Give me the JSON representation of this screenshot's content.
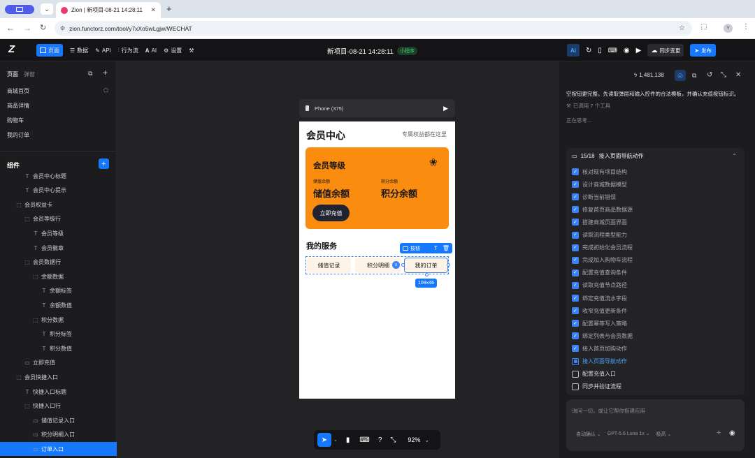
{
  "browser": {
    "tab_title": "Zion | 新项目-08-21 14:28:11",
    "new_tab": "+",
    "url": "zion.functorz.com/tool/y7xXo5wLgjw/WECHAT",
    "profile": "Y"
  },
  "topbar": {
    "logo": "Z",
    "nav": [
      {
        "label": "页面",
        "icon": "pages-icon"
      },
      {
        "label": "数据",
        "icon": "database-icon"
      },
      {
        "label": "API",
        "icon": "api-icon"
      },
      {
        "label": "行为流",
        "icon": "flow-icon"
      },
      {
        "label": "AI",
        "icon": "ai-icon"
      },
      {
        "label": "设置",
        "icon": "gear-icon"
      }
    ],
    "project_title": "新项目-08-21 14:28:11",
    "platform_badge": "小程序",
    "ai_label": "Ai",
    "sync_label": "同步变更",
    "publish_label": "发布"
  },
  "left": {
    "tabs": [
      "页面",
      "弹窗"
    ],
    "pages": [
      "商城首页",
      "商品详情",
      "购物车",
      "我的订单"
    ],
    "components_title": "组件",
    "tree": [
      {
        "label": "会员中心标题",
        "indent": 1,
        "icon": "T"
      },
      {
        "label": "会员中心提示",
        "indent": 1,
        "icon": "T"
      },
      {
        "label": "会员权益卡",
        "indent": 0,
        "icon": "box"
      },
      {
        "label": "会员等级行",
        "indent": 1,
        "icon": "box"
      },
      {
        "label": "会员等级",
        "indent": 2,
        "icon": "T"
      },
      {
        "label": "会员徽章",
        "indent": 2,
        "icon": "T"
      },
      {
        "label": "会员数据行",
        "indent": 1,
        "icon": "box"
      },
      {
        "label": "余额数据",
        "indent": 2,
        "icon": "box"
      },
      {
        "label": "余额标签",
        "indent": 3,
        "icon": "T"
      },
      {
        "label": "余额数值",
        "indent": 3,
        "icon": "T"
      },
      {
        "label": "积分数据",
        "indent": 2,
        "icon": "box"
      },
      {
        "label": "积分标签",
        "indent": 3,
        "icon": "T"
      },
      {
        "label": "积分数值",
        "indent": 3,
        "icon": "T"
      },
      {
        "label": "立即充值",
        "indent": 1,
        "icon": "btn"
      },
      {
        "label": "会员快捷入口",
        "indent": 0,
        "icon": "box"
      },
      {
        "label": "快捷入口标题",
        "indent": 1,
        "icon": "T"
      },
      {
        "label": "快捷入口行",
        "indent": 1,
        "icon": "box"
      },
      {
        "label": "储值记录入口",
        "indent": 2,
        "icon": "btn"
      },
      {
        "label": "积分明细入口",
        "indent": 2,
        "icon": "btn"
      },
      {
        "label": "订单入口",
        "indent": 2,
        "icon": "btn",
        "selected": true
      }
    ]
  },
  "phone": {
    "device_label": "Phone (375)",
    "title": "会员中心",
    "hint": "专属权益都在这里",
    "card": {
      "level": "会员等级",
      "balance_label": "储值余额",
      "balance_value": "储值余额",
      "points_label": "积分余额",
      "points_value": "积分余额",
      "recharge": "立即充值"
    },
    "services_title": "我的服务",
    "services": [
      "储值记录",
      "积分明细",
      "我的订单"
    ],
    "selection": {
      "tag": "按钮",
      "size": "109x46"
    }
  },
  "bottom_toolbar": {
    "zoom": "92%"
  },
  "right": {
    "token_count": "1,481,138",
    "message": "空按钮更完整。先读取弹层和输入控件的合法模板，并确认充值按钮标识。",
    "tools_used": "已调用 7 个工具",
    "thinking": "正在思考...",
    "plan_progress": "15/18",
    "plan_title": "接入页面导航动作",
    "tasks": [
      {
        "label": "核对现有项目结构",
        "state": "done"
      },
      {
        "label": "设计商城数据模型",
        "state": "done"
      },
      {
        "label": "诊断当前错误",
        "state": "done"
      },
      {
        "label": "修复首页商品数据源",
        "state": "done"
      },
      {
        "label": "搭建商城页面界面",
        "state": "done"
      },
      {
        "label": "读取流程类型能力",
        "state": "done"
      },
      {
        "label": "完成初始化会员流程",
        "state": "done"
      },
      {
        "label": "完成加入购物车流程",
        "state": "done"
      },
      {
        "label": "配置充值查询条件",
        "state": "done"
      },
      {
        "label": "读取充值节点路径",
        "state": "done"
      },
      {
        "label": "绑定充值流水字段",
        "state": "done"
      },
      {
        "label": "收窄充值更新条件",
        "state": "done"
      },
      {
        "label": "配置幂等写入策略",
        "state": "done"
      },
      {
        "label": "绑定列表与会员数据",
        "state": "done"
      },
      {
        "label": "接入首页加购动作",
        "state": "done"
      },
      {
        "label": "接入页面导航动作",
        "state": "current"
      },
      {
        "label": "配置充值入口",
        "state": "todo"
      },
      {
        "label": "同步并验证流程",
        "state": "todo"
      }
    ],
    "input_placeholder": "询问一切，或让它帮你搭建应用",
    "mode": "自动确认",
    "model": "GPT-5.6 Luna 1x",
    "level": "极高",
    "plus": "+"
  },
  "colors": {
    "accent": "#1677ff",
    "orange": "#fa8c0f",
    "dark": "#141416"
  }
}
